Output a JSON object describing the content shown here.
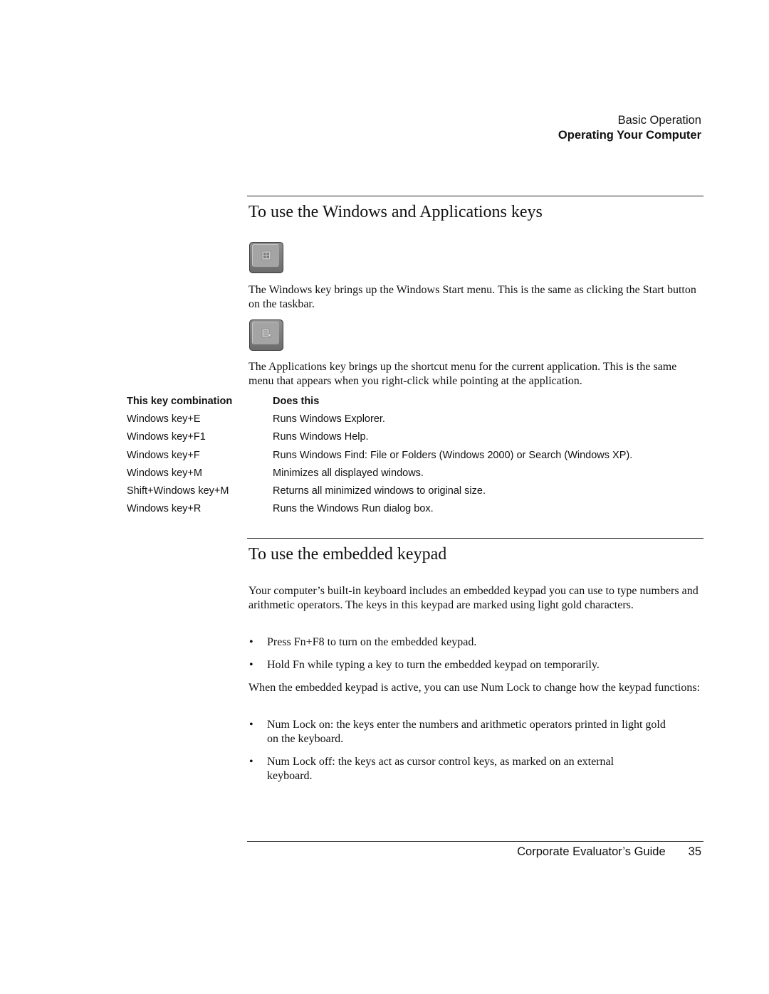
{
  "header": {
    "section": "Basic Operation",
    "chapter": "Operating Your Computer"
  },
  "section1": {
    "title": "To use the Windows and Applications keys",
    "windows_key_icon": "windows-key-icon",
    "windows_key_text": "The Windows key brings up the Windows Start menu. This is the same as clicking the Start button on the taskbar.",
    "apps_key_icon": "applications-key-icon",
    "apps_key_text": "The Applications key brings up the shortcut menu for the current application. This is the same menu that appears when you right-click while pointing at the application.",
    "table": {
      "headers": [
        "This key combination",
        "Does this"
      ],
      "rows": [
        [
          "Windows key+E",
          "Runs Windows Explorer."
        ],
        [
          "Windows key+F1",
          "Runs Windows Help."
        ],
        [
          "Windows key+F",
          "Runs Windows Find: File or Folders (Windows 2000) or Search (Windows XP)."
        ],
        [
          "Windows key+M",
          "Minimizes all displayed windows."
        ],
        [
          "Shift+Windows key+M",
          "Returns all minimized windows to original size."
        ],
        [
          "Windows key+R",
          "Runs the Windows Run dialog box."
        ]
      ]
    }
  },
  "section2": {
    "title": "To use the embedded keypad",
    "intro": "Your computer’s built-in keyboard includes an embedded keypad you can use to type numbers and arithmetic operators. The keys in this keypad are marked using light gold characters.",
    "bullets1": [
      "Press Fn+F8 to turn on the embedded keypad.",
      "Hold Fn while typing a key to turn the embedded keypad on temporarily."
    ],
    "numlock_intro": "When the embedded keypad is active, you can use Num Lock to change how the keypad functions:",
    "bullets2": [
      "Num Lock on: the keys enter the numbers and arithmetic operators printed in light gold on the keyboard.",
      "Num Lock off: the keys act as cursor control keys, as marked on an external keyboard."
    ],
    "bullet_glyph": "•"
  },
  "footer": {
    "guide_title": "Corporate Evaluator’s Guide",
    "page_number": "35"
  }
}
